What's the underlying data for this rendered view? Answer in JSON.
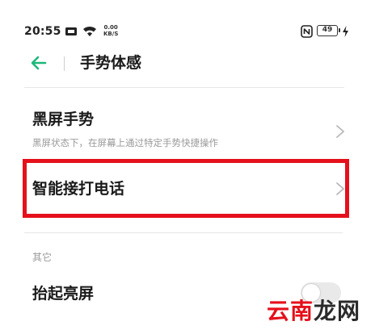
{
  "status_bar": {
    "time": "20:55",
    "net_speed_value": "0.00",
    "net_speed_unit": "KB/S",
    "battery_level": "49",
    "icons": [
      "notification-icon",
      "wifi-icon",
      "nfc-icon",
      "charging-icon"
    ]
  },
  "header": {
    "back_icon": "arrow-left-icon",
    "title": "手势体感"
  },
  "items": [
    {
      "title": "黑屏手势",
      "subtitle": "黑屏状态下，在屏幕上通过特定手势快捷操作",
      "icon": "chevron-right-icon"
    },
    {
      "title": "智能接打电话",
      "icon": "chevron-right-icon"
    }
  ],
  "section_other": {
    "label": "其它",
    "items": [
      {
        "title": "抬起亮屏",
        "toggle_on": false
      }
    ]
  },
  "watermark": {
    "text_1": "云",
    "text_2": "南",
    "text_3": "龙",
    "text_4": "网"
  },
  "colors": {
    "accent_green": "#1db87a",
    "highlight_red": "#e5101b",
    "secondary_text": "#9a9a9a"
  }
}
